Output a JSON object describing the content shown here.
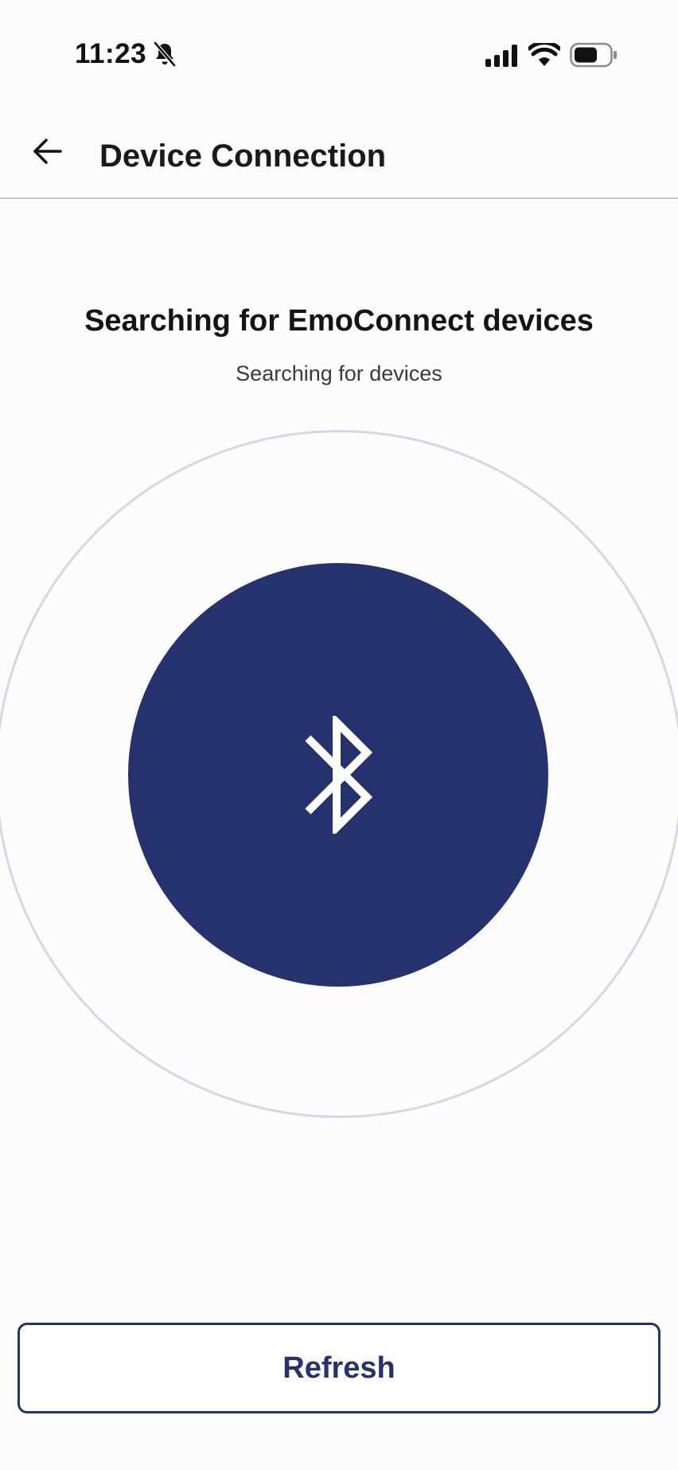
{
  "status_bar": {
    "time": "11:23",
    "icons": [
      "bell-slash-icon",
      "signal-icon",
      "wifi-icon",
      "battery-icon"
    ]
  },
  "header": {
    "back_icon": "arrow-left-icon",
    "title": "Device Connection"
  },
  "main": {
    "heading": "Searching for EmoConnect devices",
    "subheading": "Searching for devices",
    "center_icon": "bluetooth-icon",
    "accent_color": "#26326e",
    "ring_color": "#d6d6e6"
  },
  "footer": {
    "refresh_label": "Refresh"
  }
}
